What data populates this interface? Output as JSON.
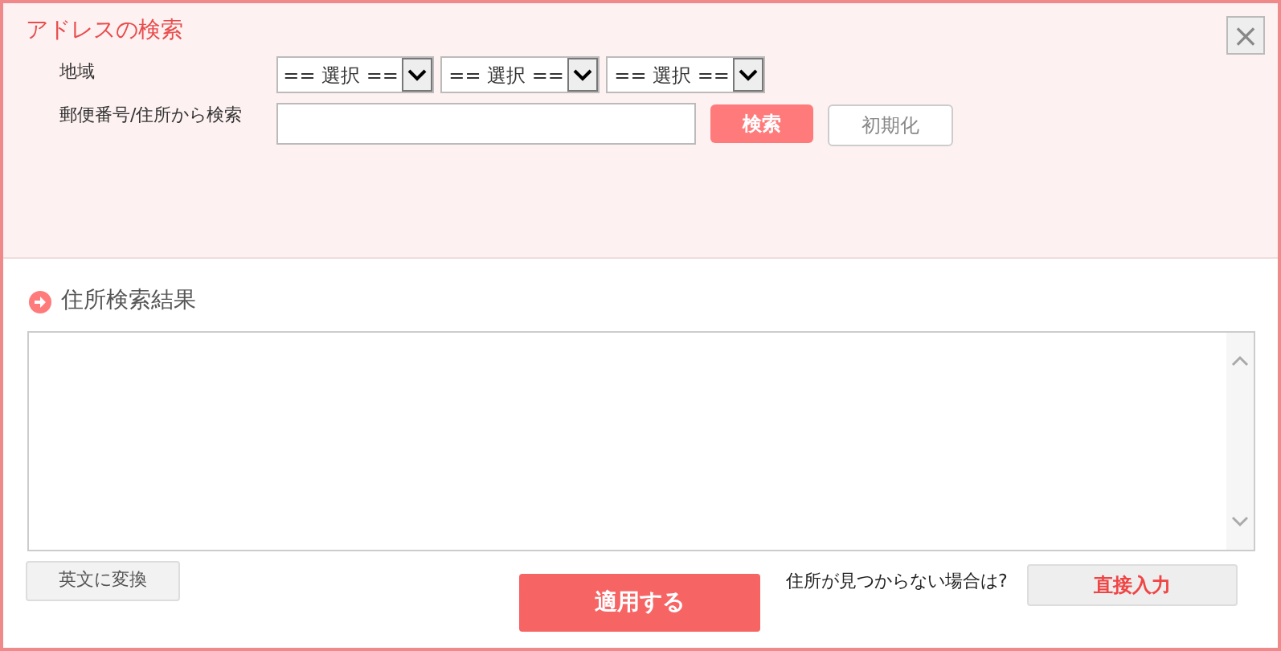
{
  "dialog": {
    "title": "アドレスの検索",
    "close": "×"
  },
  "search": {
    "region_label": "地域",
    "selects": [
      {
        "value": "== 選択 =="
      },
      {
        "value": "== 選択 =="
      },
      {
        "value": "== 選択 =="
      }
    ],
    "query_label": "郵便番号/住所から検索",
    "search_button": "検索",
    "reset_button": "初期化"
  },
  "results": {
    "heading": "住所検索結果"
  },
  "footer": {
    "convert_button": "英文に変換",
    "apply_button": "適用する",
    "not_found_text": "住所が見つからない場合は?",
    "direct_button": "直接入力"
  }
}
